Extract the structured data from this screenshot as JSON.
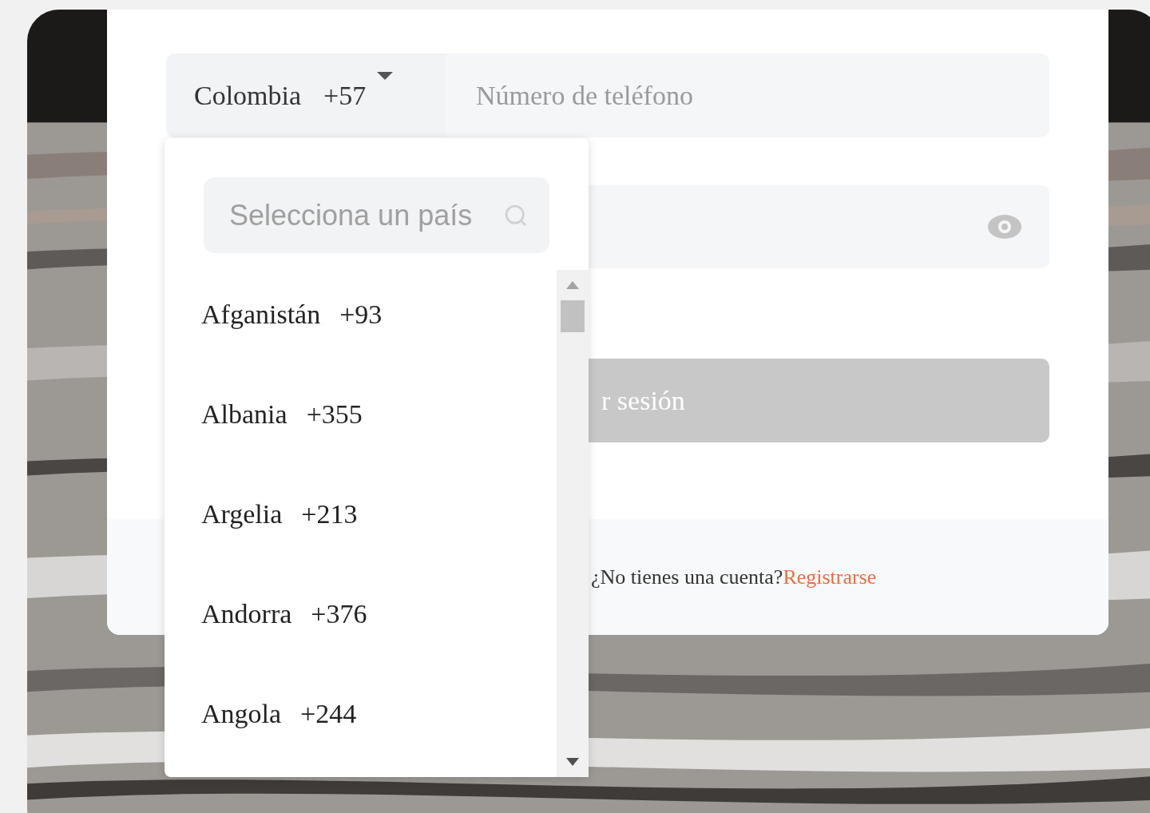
{
  "phone": {
    "country": "Colombia",
    "code": "+57",
    "placeholder": "Número de teléfono"
  },
  "login_button": {
    "label": "r sesión",
    "disabled": true
  },
  "footer": {
    "prompt": "¿No tienes una cuenta?",
    "link": "Registrarse"
  },
  "country_dropdown": {
    "open": true,
    "search_placeholder": "Selecciona un país",
    "items": [
      {
        "name": "Afganistán",
        "code": "+93"
      },
      {
        "name": "Albania",
        "code": "+355"
      },
      {
        "name": "Argelia",
        "code": "+213"
      },
      {
        "name": "Andorra",
        "code": "+376"
      },
      {
        "name": "Angola",
        "code": "+244"
      }
    ]
  }
}
